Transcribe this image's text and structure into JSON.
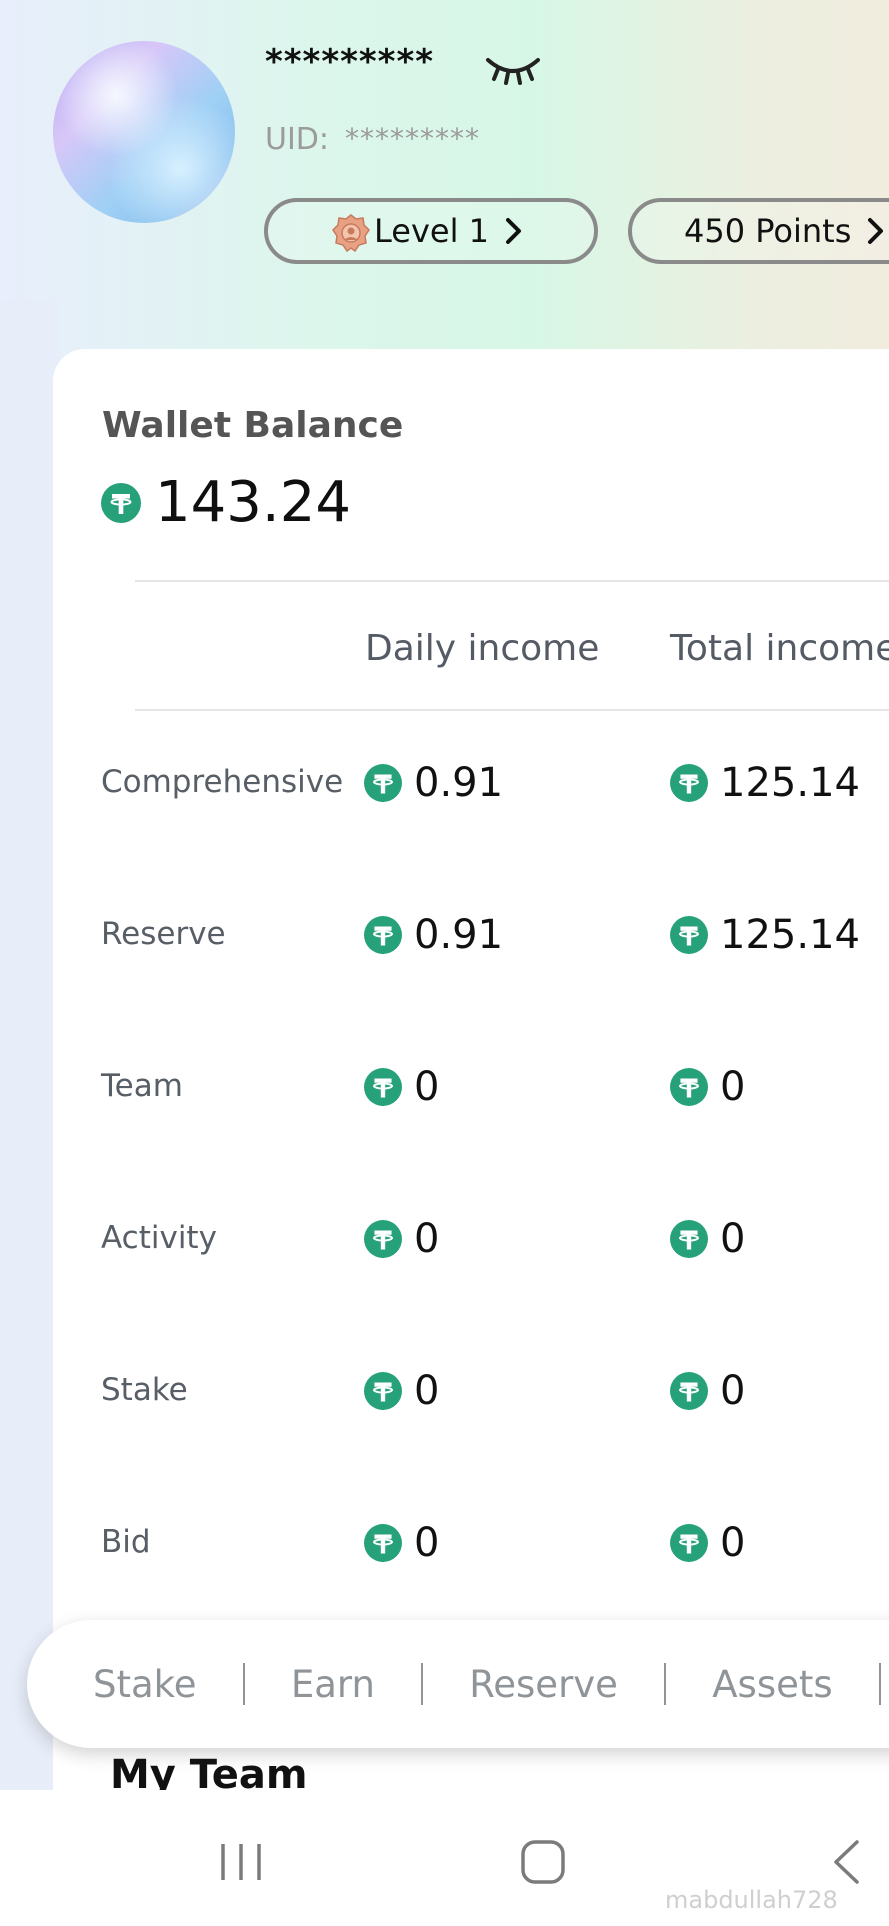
{
  "profile": {
    "username": "*********",
    "uid_label": "UID:",
    "uid_value": "*********",
    "level_label": "Level 1",
    "points_label": "450 Points"
  },
  "wallet": {
    "label": "Wallet Balance",
    "balance": "143.24"
  },
  "table": {
    "headers": [
      "Daily income",
      "Total income"
    ],
    "rows": [
      {
        "label": "Comprehensive",
        "daily": "0.91",
        "total": "125.14"
      },
      {
        "label": "Reserve",
        "daily": "0.91",
        "total": "125.14"
      },
      {
        "label": "Team",
        "daily": "0",
        "total": "0"
      },
      {
        "label": "Activity",
        "daily": "0",
        "total": "0"
      },
      {
        "label": "Stake",
        "daily": "0",
        "total": "0"
      },
      {
        "label": "Bid",
        "daily": "0",
        "total": "0"
      }
    ]
  },
  "tabs": [
    "Stake",
    "Earn",
    "Reserve",
    "Assets"
  ],
  "section_title": "My Team",
  "watermark": "mabdullah728",
  "colors": {
    "coin": "#27a17a",
    "text_primary": "#111111",
    "text_secondary": "#585e66"
  },
  "icons": [
    "eye-closed-icon",
    "level-badge-icon",
    "chevron-right-icon",
    "usdt-coin-icon",
    "recents-icon",
    "home-icon",
    "back-icon"
  ]
}
